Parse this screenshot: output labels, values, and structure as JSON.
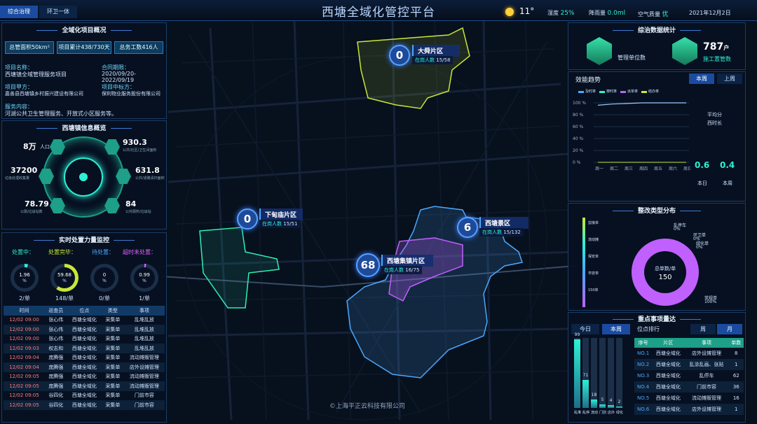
{
  "header": {
    "title": "西塘全域化管控平台",
    "tab_left": "综合治理",
    "tab_right": "环卫一体",
    "temp": "11°",
    "humidity_label": "湿度",
    "humidity": "25%",
    "rain_label": "降雨量",
    "rain": "0.0ml",
    "air_label": "空气质量",
    "air": "优",
    "date": "2021年12月2日"
  },
  "overview": {
    "title": "全域化项目概况",
    "area": "总管面积50km²",
    "days": "项目累计438/730天",
    "workers": "总务工数416人",
    "name_label": "项目名称：",
    "name": "西塘镇全域管理服务项目",
    "term_label": "合同期限：",
    "term": "2020/09/20-2022/09/19",
    "owner_label": "项目甲方：",
    "owner": "嘉善县西塘镇乡村振兴建设有限公司",
    "vendor_label": "项目中标方：",
    "vendor": "保利物业服务股份有限公司",
    "content_label": "服务内容：",
    "content": "河湖公共卫生管理服务、开放式小区服务等。"
  },
  "town": {
    "title": "西塘镇信息概览",
    "population": "8万",
    "population_label": "人口",
    "v1": "930.3",
    "v1_label": "公共/社区/卫生间面积",
    "v2": "37200",
    "v2_label": "垃圾处理收集量",
    "v3": "631.8",
    "v3_label": "公共/道路清扫面积",
    "v4": "78.79",
    "v4_label": "公厕/垃圾站数",
    "v5": "84",
    "v5_label": "公共厕所/垃圾站"
  },
  "monitor": {
    "title": "实时处置力量监控",
    "legend": [
      "处置中：",
      "处置完毕：",
      "待处置：",
      "超时未处置："
    ],
    "gauges": [
      {
        "value": "1.96",
        "pct": "%",
        "sub": "2/单",
        "color": "#2ef0d5",
        "fill": 0.04
      },
      {
        "value": "59.68",
        "pct": "%",
        "sub": "148/单",
        "color": "#c8e63a",
        "fill": 0.6
      },
      {
        "value": "0",
        "pct": "%",
        "sub": "0/单",
        "color": "#4aa8ff",
        "fill": 0
      },
      {
        "value": "0.99",
        "pct": "%",
        "sub": "1/单",
        "color": "#e060ff",
        "fill": 0.02
      }
    ],
    "headers": [
      "时间",
      "巡查员",
      "位点",
      "类型",
      "事项"
    ],
    "rows": [
      [
        "12/02 09:00",
        "张心伟",
        "西塘全域化",
        "采集单",
        "乱堆乱放"
      ],
      [
        "12/02 09:00",
        "张心伟",
        "西塘全域化",
        "采集单",
        "乱堆乱放"
      ],
      [
        "12/02 09:00",
        "张心伟",
        "西塘全域化",
        "采集单",
        "乱堆乱放"
      ],
      [
        "12/02 09:03",
        "权志和",
        "西塘全域化",
        "采集单",
        "乱堆乱放"
      ],
      [
        "12/02 09:04",
        "庞腾强",
        "西塘全域化",
        "采集单",
        "流动摊贩管理"
      ],
      [
        "12/02 09:04",
        "庞腾强",
        "西塘全域化",
        "采集单",
        "店外设摊管理"
      ],
      [
        "12/02 09:05",
        "庞腾强",
        "西塘全域化",
        "采集单",
        "流动摊贩管理"
      ],
      [
        "12/02 09:05",
        "庞腾强",
        "西塘全域化",
        "采集单",
        "流动摊贩管理"
      ],
      [
        "12/02 09:05",
        "谷四化",
        "西塘全域化",
        "采集单",
        "门前市容"
      ],
      [
        "12/02 09:05",
        "谷四化",
        "西塘全域化",
        "采集单",
        "门前市容"
      ]
    ]
  },
  "map": {
    "zones": [
      {
        "name": "大舜片区",
        "count": "0",
        "people_label": "在岗人数",
        "people": "15/58"
      },
      {
        "name": "下甸庙片区",
        "count": "0",
        "people_label": "在岗人数",
        "people": "15/51"
      },
      {
        "name": "西塘景区",
        "count": "6",
        "people_label": "在岗人数",
        "people": "15/132"
      },
      {
        "name": "西塘集镇片区",
        "count": "68",
        "people_label": "在岗人数",
        "people": "16/75"
      }
    ],
    "copyright": "©上海平正云科技有限公司"
  },
  "stats": {
    "title": "综治数据统计",
    "label1": "管理单位数",
    "value2": "787",
    "unit2": "户",
    "label2": "施工置管数"
  },
  "trend": {
    "title": "效能趋势",
    "tab_week": "本周",
    "tab_last": "上周",
    "legend": [
      "及时率",
      "按时率",
      "派单率",
      "结办率"
    ],
    "days": [
      "周一",
      "周二",
      "周三",
      "周四",
      "周五",
      "周六",
      "周日"
    ],
    "yticks": [
      "100 %",
      "80 %",
      "60 %",
      "40 %",
      "20 %",
      "0 %"
    ],
    "side1": "平均分",
    "side2": "西时长",
    "val1": "0.6",
    "val1_label": "本日",
    "val2": "0.4",
    "val2_label": "本周"
  },
  "dist": {
    "title": "整改类型分布",
    "center_label": "总单数/单",
    "center_value": "150",
    "legend": [
      {
        "name": "乱停车",
        "pct": "0%"
      },
      {
        "name": "环卫单",
        "pct": "0%"
      },
      {
        "name": "绿化单",
        "pct": "0%"
      },
      {
        "name": "常规单",
        "pct": "100%"
      }
    ],
    "bar_labels": [
      "剪接单",
      "流动摊",
      "保安单",
      "市容单",
      "150单"
    ]
  },
  "rank": {
    "title": "重点事项量达",
    "tab_today": "今日",
    "tab_week": "本周",
    "tab_pos": "位点排行",
    "tab_w": "周",
    "tab_m": "月",
    "bar_values": [
      "99",
      "71",
      "18",
      "5",
      "4",
      "2"
    ],
    "bar_fill": [
      0.98,
      0.4,
      0.12,
      0.05,
      0.04,
      0.02
    ],
    "bar_labels": [
      "乱堆",
      "乱停",
      "流动",
      "门前",
      "店外",
      "绿化"
    ],
    "headers": [
      "序号",
      "片区",
      "事项",
      "单数"
    ],
    "rows": [
      [
        "NO.1",
        "西塘全域化",
        "店外设摊管理",
        "8"
      ],
      [
        "NO.2",
        "西塘全域化",
        "乱涂乱画、张贴",
        "1"
      ],
      [
        "NO.3",
        "西塘全域化",
        "乱停车",
        "62"
      ],
      [
        "NO.4",
        "西塘全域化",
        "门前市容",
        "36"
      ],
      [
        "NO.5",
        "西塘全域化",
        "流动摊贩管理",
        "16"
      ],
      [
        "NO.6",
        "西塘全域化",
        "店外设摊管理",
        "1"
      ]
    ]
  }
}
